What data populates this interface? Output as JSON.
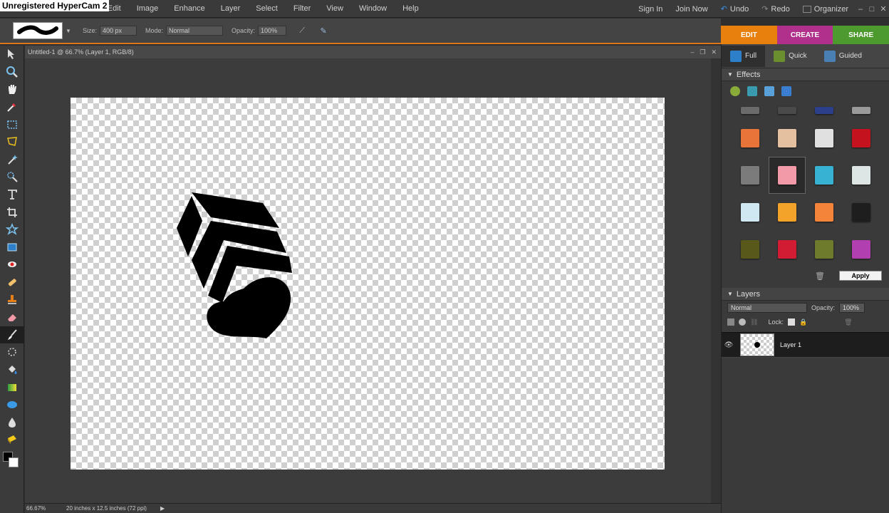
{
  "watermark": "Unregistered HyperCam 2",
  "menu": {
    "items": [
      "File",
      "Edit",
      "Image",
      "Enhance",
      "Layer",
      "Select",
      "Filter",
      "View",
      "Window",
      "Help"
    ],
    "sign_in": "Sign In",
    "join_now": "Join Now",
    "undo": "Undo",
    "redo": "Redo",
    "organizer": "Organizer"
  },
  "options": {
    "size_label": "Size:",
    "size_value": "400 px",
    "mode_label": "Mode:",
    "mode_value": "Normal",
    "opacity_label": "Opacity:",
    "opacity_value": "100%"
  },
  "modetabs": {
    "edit": "EDIT",
    "create": "CREATE",
    "share": "SHARE"
  },
  "document": {
    "title": "Untitled-1 @ 66.7% (Layer 1, RGB/8)"
  },
  "status": {
    "zoom": "66.67%",
    "docsize": "20 inches x 12.5 inches (72 ppi)"
  },
  "panel": {
    "view_tabs": {
      "full": "Full",
      "quick": "Quick",
      "guided": "Guided"
    },
    "effects_title": "Effects",
    "apply_label": "Apply",
    "layers_title": "Layers",
    "blend_mode": "Normal",
    "opacity_label": "Opacity:",
    "opacity_value": "100%",
    "lock_label": "Lock:",
    "layer_name": "Layer 1"
  },
  "effect_swatches": [
    [
      "#6b6b6b",
      "#4a4a4a",
      "#2b3f8a",
      "#9a9a9a"
    ],
    [
      "#e8743a",
      "#e4bfa0",
      "#e0e0e0",
      "#c4121e"
    ],
    [
      "#7b7b7b",
      "#f29aa8",
      "#37b2d2",
      "#dde6e4"
    ],
    [
      "#cfe8f2",
      "#f3a22a",
      "#f3843a",
      "#1e1e1e"
    ],
    [
      "#57581a",
      "#d21c34",
      "#6e7a2c",
      "#b23fb0"
    ]
  ],
  "colors": {
    "accent": "#e8800e",
    "create": "#b0308c",
    "share": "#4d9a2e"
  }
}
